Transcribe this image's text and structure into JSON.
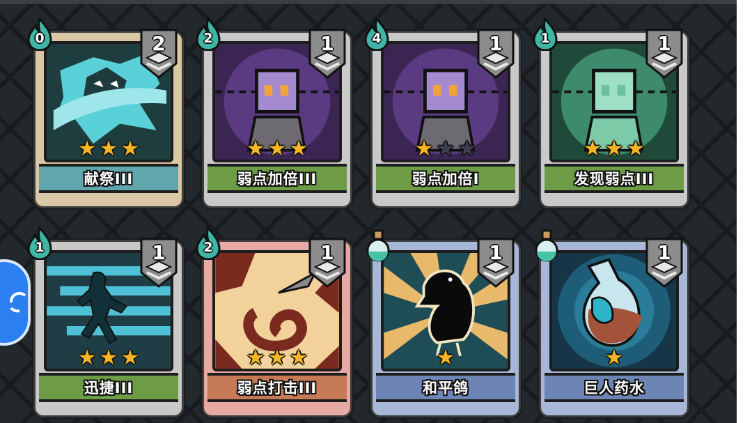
{
  "cards": [
    {
      "name": "献祭III",
      "cost": "0",
      "level": "2",
      "stars": 3,
      "cost_type": "flame"
    },
    {
      "name": "弱点加倍III",
      "cost": "2",
      "level": "1",
      "stars": 3,
      "cost_type": "flame"
    },
    {
      "name": "弱点加倍I",
      "cost": "4",
      "level": "1",
      "stars": 1,
      "cost_type": "flame"
    },
    {
      "name": "发现弱点III",
      "cost": "1",
      "level": "1",
      "stars": 3,
      "cost_type": "flame"
    },
    {
      "name": "迅捷III",
      "cost": "1",
      "level": "1",
      "stars": 3,
      "cost_type": "flame"
    },
    {
      "name": "弱点打击III",
      "cost": "2",
      "level": "1",
      "stars": 3,
      "cost_type": "flame"
    },
    {
      "name": "和平鸽",
      "cost": "",
      "level": "1",
      "stars": 1,
      "cost_type": "potion"
    },
    {
      "name": "巨人药水",
      "cost": "",
      "level": "1",
      "stars": 1,
      "cost_type": "potion"
    }
  ],
  "colors": {
    "background": "#23282d",
    "star_on": "#f4b625",
    "star_off": "#3e3f52",
    "flame": "#3fb5a5",
    "side_button": "#2b7ff0"
  },
  "icons": {
    "cost": "flame-icon",
    "potion": "potion-flask-icon",
    "level": "stacked-layers-icon",
    "side_button": "refresh-icon"
  }
}
